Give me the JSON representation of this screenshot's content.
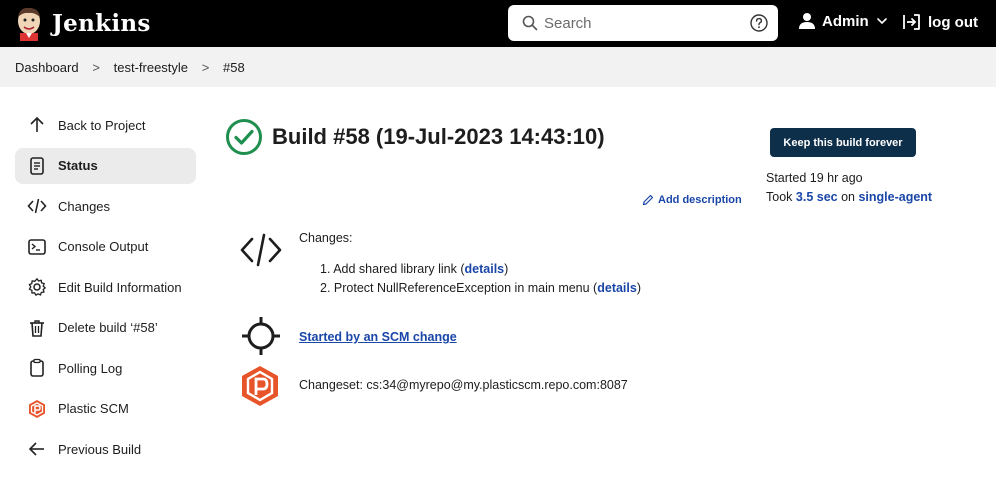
{
  "header": {
    "brand": "Jenkins",
    "search_placeholder": "Search",
    "user": "Admin",
    "logout": "log out"
  },
  "breadcrumb": [
    "Dashboard",
    "test-freestyle",
    "#58"
  ],
  "sidebar": {
    "items": [
      {
        "label": "Back to Project",
        "icon": "arrow-up-icon"
      },
      {
        "label": "Status",
        "icon": "document-icon"
      },
      {
        "label": "Changes",
        "icon": "code-icon"
      },
      {
        "label": "Console Output",
        "icon": "terminal-icon"
      },
      {
        "label": "Edit Build Information",
        "icon": "gear-icon"
      },
      {
        "label": "Delete build ‘#58’",
        "icon": "trash-icon"
      },
      {
        "label": "Polling Log",
        "icon": "clipboard-icon"
      },
      {
        "label": "Plastic SCM",
        "icon": "plastic-scm-icon"
      },
      {
        "label": "Previous Build",
        "icon": "arrow-left-icon"
      }
    ]
  },
  "main": {
    "title": "Build #58 (19-Jul-2023 14:43:10)",
    "keep_button": "Keep this build forever",
    "started": "Started 19 hr ago",
    "took_prefix": "Took ",
    "took_duration": "3.5 sec",
    "took_on": " on ",
    "took_agent": "single-agent",
    "add_description": "Add description",
    "changes_label": "Changes:",
    "changes": [
      {
        "num": "1. ",
        "text": "Add shared library link (",
        "link": "details",
        "close": ")"
      },
      {
        "num": "2. ",
        "text": "Protect NullReferenceException in main menu (",
        "link": "details",
        "close": ")"
      }
    ],
    "scm_cause": "Started by an SCM change",
    "changeset": "Changeset: cs:34@myrepo@my.plasticscm.repo.com:8087"
  },
  "colors": {
    "header_bg": "#000000",
    "accent_link": "#1a46a8",
    "button_bg": "#0e2f4a",
    "success": "#1e8f4e",
    "plastic": "#e8542a"
  }
}
